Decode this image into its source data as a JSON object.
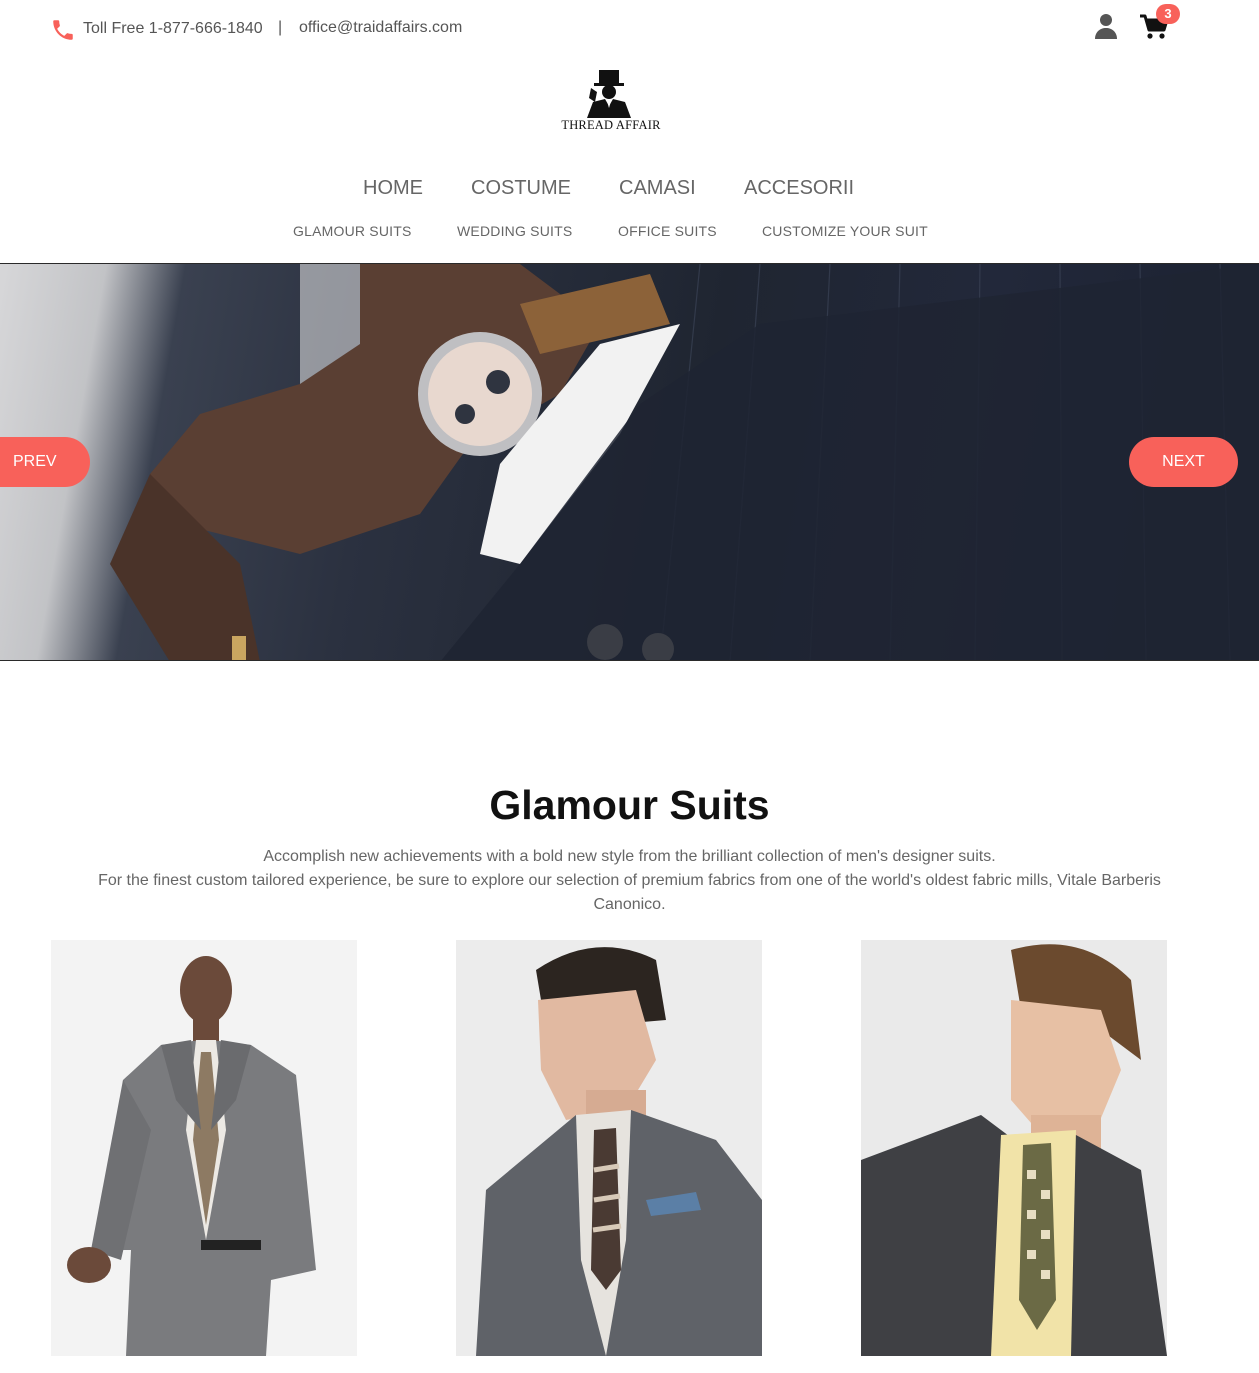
{
  "topbar": {
    "phone_icon": "phone-icon",
    "tollfree": "Toll Free 1-877-666-1840",
    "separator": "|",
    "email": "office@traidaffairs.com",
    "user_icon": "user-icon",
    "cart_icon": "cart-icon",
    "cart_count": "3"
  },
  "logo": {
    "text": "THREAD AFFAIR"
  },
  "nav": {
    "main": [
      "HOME",
      "COSTUME",
      "CAMASI",
      "ACCESORII"
    ],
    "sub": [
      "GLAMOUR SUITS",
      "WEDDING SUITS",
      "OFFICE SUITS",
      "CUSTOMIZE YOUR SUIT"
    ]
  },
  "slider": {
    "prev": "PREV",
    "next": "NEXT"
  },
  "section": {
    "title_light": "Glamour ",
    "title_bold": "Suits",
    "desc_line1": "Accomplish new achievements with a bold new style from the brilliant collection of men's designer suits.",
    "desc_line2": "For the finest custom tailored experience, be sure to explore our selection of premium fabrics from one of the world's oldest fabric mills, Vitale Barberis Canonico."
  },
  "colors": {
    "accent": "#f8615a",
    "text": "#555555",
    "heading": "#111111"
  }
}
